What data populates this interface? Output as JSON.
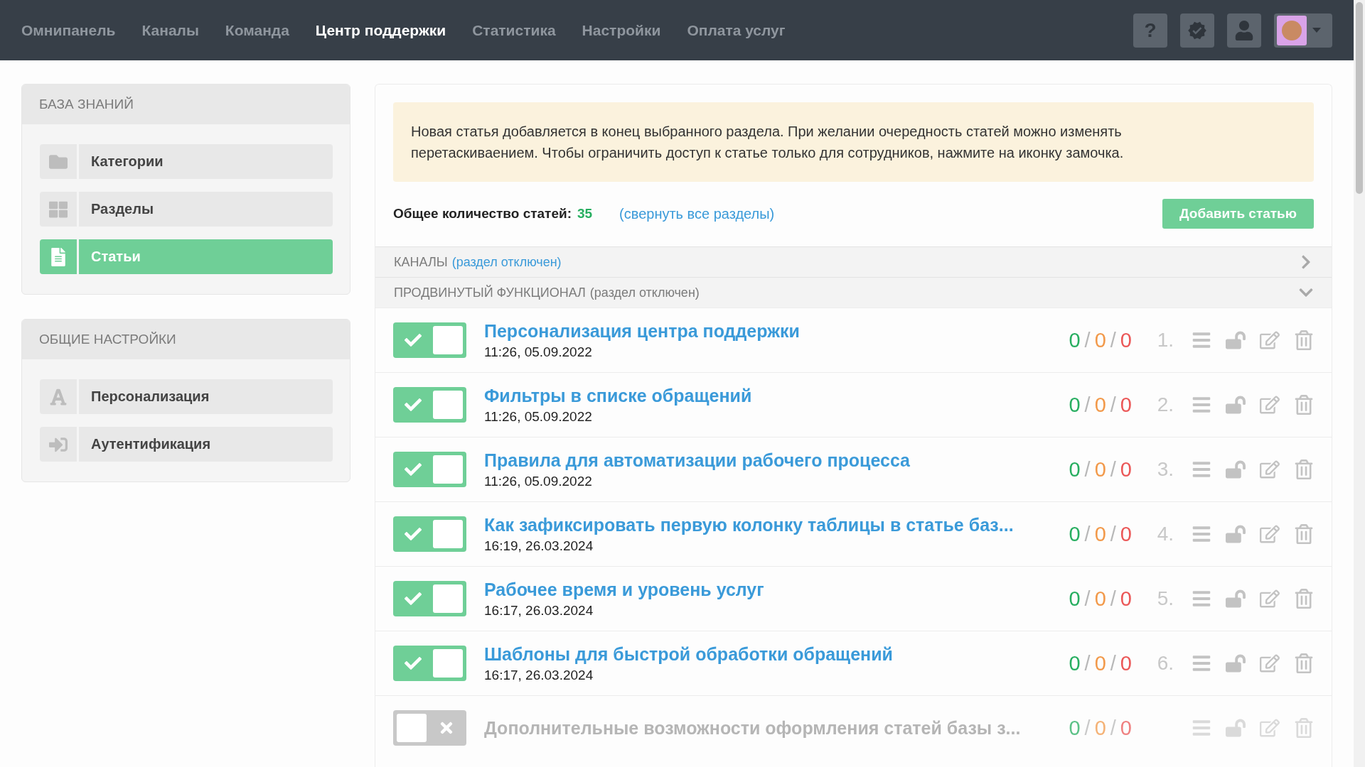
{
  "nav": {
    "items": [
      {
        "label": "Омнипанель",
        "selected": false
      },
      {
        "label": "Каналы",
        "selected": false
      },
      {
        "label": "Команда",
        "selected": false
      },
      {
        "label": "Центр поддержки",
        "selected": true
      },
      {
        "label": "Статистика",
        "selected": false
      },
      {
        "label": "Настройки",
        "selected": false
      },
      {
        "label": "Оплата услуг",
        "selected": false
      }
    ],
    "help_label": "?"
  },
  "sidebar": {
    "groups": [
      {
        "title": "БАЗА ЗНАНИЙ",
        "items": [
          {
            "label": "Категории",
            "kind": "folder",
            "selected": false
          },
          {
            "label": "Разделы",
            "kind": "grid",
            "selected": false
          },
          {
            "label": "Статьи",
            "kind": "file",
            "selected": true
          }
        ]
      },
      {
        "title": "ОБЩИЕ НАСТРОЙКИ",
        "items": [
          {
            "label": "Персонализация",
            "kind": "font",
            "selected": false
          },
          {
            "label": "Аутентификация",
            "kind": "signin",
            "selected": false
          }
        ]
      }
    ]
  },
  "notice": "Новая статья добавляется в конец выбранного раздела. При желании очередность статей можно изменять перетаскиваением. Чтобы ограничить доступ к статье только для сотрудников, нажмите на иконку замочка.",
  "summary": {
    "label": "Общее количество статей:",
    "count": "35",
    "collapse_link": "(свернуть все разделы)",
    "add_button": "Добавить статью"
  },
  "sections": [
    {
      "name": "КАНАЛЫ",
      "status": "(раздел отключен)",
      "status_highlighted": true,
      "expanded": false
    },
    {
      "name": "ПРОДВИНУТЫЙ ФУНКЦИОНАЛ",
      "status": "(раздел отключен)",
      "status_highlighted": false,
      "expanded": true,
      "articles": [
        {
          "title": "Персонализация центра поддержки",
          "date": "11:26, 05.09.2022",
          "enabled": true,
          "counts": [
            "0",
            "0",
            "0"
          ],
          "separators": [
            "/",
            "/"
          ],
          "number": "1."
        },
        {
          "title": "Фильтры в списке обращений",
          "date": "11:26, 05.09.2022",
          "enabled": true,
          "counts": [
            "0",
            "0",
            "0"
          ],
          "separators": [
            "/",
            "/"
          ],
          "number": "2."
        },
        {
          "title": "Правила для автоматизации рабочего процесса",
          "date": "11:26, 05.09.2022",
          "enabled": true,
          "counts": [
            "0",
            "0",
            "0"
          ],
          "separators": [
            "/",
            "/"
          ],
          "number": "3."
        },
        {
          "title": "Как зафиксировать первую колонку таблицы в статье баз...",
          "date": "16:19, 26.03.2024",
          "enabled": true,
          "counts": [
            "0",
            "0",
            "0"
          ],
          "separators": [
            "/",
            "/"
          ],
          "number": "4."
        },
        {
          "title": "Рабочее время и уровень услуг",
          "date": "16:17, 26.03.2024",
          "enabled": true,
          "counts": [
            "0",
            "0",
            "0"
          ],
          "separators": [
            "/",
            "/"
          ],
          "number": "5."
        },
        {
          "title": "Шаблоны для быстрой обработки обращений",
          "date": "16:17, 26.03.2024",
          "enabled": true,
          "counts": [
            "0",
            "0",
            "0"
          ],
          "separators": [
            "/",
            "/"
          ],
          "number": "6."
        },
        {
          "title": "Дополнительные возможности оформления статей базы з...",
          "enabled": false,
          "counts": [
            "0",
            "0",
            "0"
          ],
          "separators": [
            "/",
            "/"
          ]
        }
      ]
    }
  ]
}
